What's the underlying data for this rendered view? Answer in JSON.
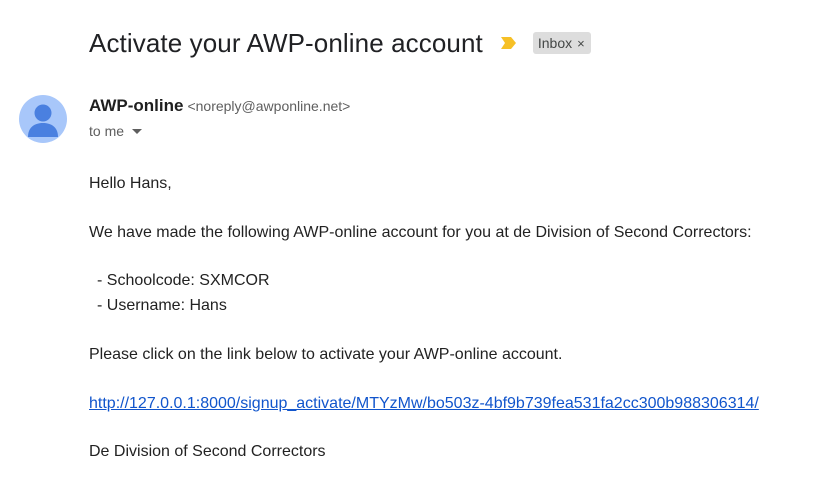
{
  "email": {
    "subject": "Activate your AWP-online account",
    "label_chip": "Inbox",
    "label_close": "×",
    "icons": {
      "importance": "importance-marker-icon",
      "avatar": "person-avatar-icon",
      "caret": "chevron-down-icon"
    },
    "colors": {
      "importance": "#f6c026",
      "avatar_bg": "#a8c7fa",
      "avatar_fg": "#4a80e0",
      "link": "#1155cc"
    },
    "sender": {
      "name": "AWP-online",
      "email": "<noreply@awponline.net>"
    },
    "recipient_line": "to me",
    "body": {
      "greeting": "Hello Hans,",
      "intro": "We have made the following AWP-online account for you at de Division of Second Correctors:",
      "schoolcode_line": "- Schoolcode:  SXMCOR",
      "username_line": "- Username:  Hans",
      "instruction": "Please click on the link below to activate your AWP-online account.",
      "activation_link": "http://127.0.0.1:8000/signup_activate/MTYzMw/bo503z-4bf9b739fea531fa2cc300b988306314/",
      "signature": "De Division of Second Correctors"
    }
  }
}
